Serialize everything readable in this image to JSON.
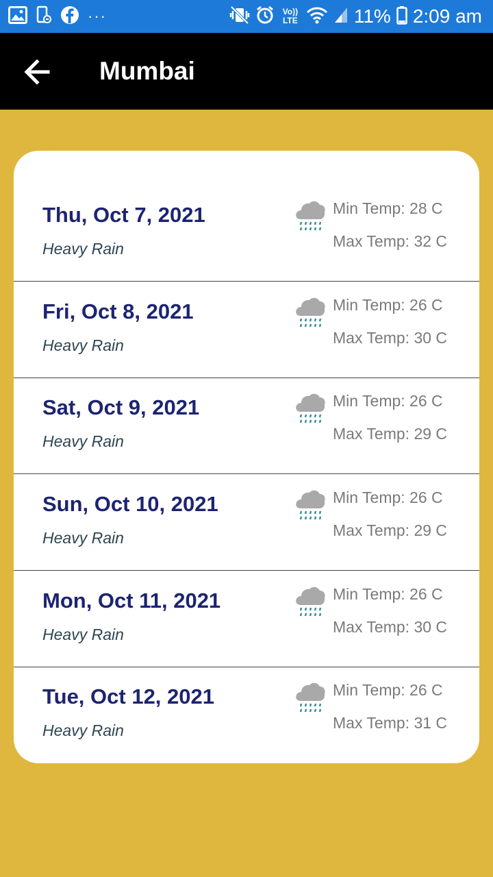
{
  "status_bar": {
    "battery": "11%",
    "time": "2:09 am",
    "more": "···",
    "volte": "Vo)) LTE"
  },
  "app_bar": {
    "title": "Mumbai",
    "back_icon": "arrow-left-icon"
  },
  "forecast": [
    {
      "date": "Thu, Oct 7, 2021",
      "condition": "Heavy Rain",
      "min": "Min Temp: 28 C",
      "max": "Max Temp: 32 C",
      "icon": "rain-cloud-icon"
    },
    {
      "date": "Fri, Oct 8, 2021",
      "condition": "Heavy Rain",
      "min": "Min Temp: 26 C",
      "max": "Max Temp: 30 C",
      "icon": "rain-cloud-icon"
    },
    {
      "date": "Sat, Oct 9, 2021",
      "condition": "Heavy Rain",
      "min": "Min Temp: 26 C",
      "max": "Max Temp: 29 C",
      "icon": "rain-cloud-icon"
    },
    {
      "date": "Sun, Oct 10, 2021",
      "condition": "Heavy Rain",
      "min": "Min Temp: 26 C",
      "max": "Max Temp: 29 C",
      "icon": "rain-cloud-icon"
    },
    {
      "date": "Mon, Oct 11, 2021",
      "condition": "Heavy Rain",
      "min": "Min Temp: 26 C",
      "max": "Max Temp: 30 C",
      "icon": "rain-cloud-icon"
    },
    {
      "date": "Tue, Oct 12, 2021",
      "condition": "Heavy Rain",
      "min": "Min Temp: 26 C",
      "max": "Max Temp: 31 C",
      "icon": "rain-cloud-icon"
    }
  ],
  "colors": {
    "status_bar": "#1E7AD8",
    "app_bar": "#000000",
    "background": "#E0B73E",
    "card": "#FFFFFF",
    "date_text": "#1D2470",
    "condition_text": "#2E4550",
    "temp_text": "#7A7A7A"
  }
}
